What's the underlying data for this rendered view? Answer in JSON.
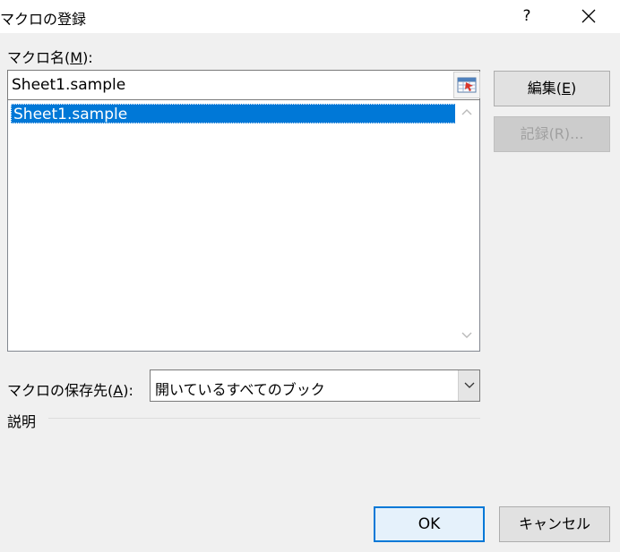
{
  "window": {
    "title": "マクロの登録",
    "help_label": "?"
  },
  "macro_name": {
    "label_prefix": "マクロ名(",
    "label_key": "M",
    "label_suffix": "):",
    "value": "Sheet1.sample"
  },
  "macro_list": {
    "items": [
      "Sheet1.sample"
    ],
    "selected_index": 0
  },
  "buttons": {
    "edit_prefix": "編集(",
    "edit_key": "E",
    "edit_suffix": ")",
    "record": "記録(R)...",
    "ok": "OK",
    "cancel": "キャンセル"
  },
  "save_in": {
    "label_prefix": "マクロの保存先(",
    "label_key": "A",
    "label_suffix": "):",
    "value": "開いているすべてのブック"
  },
  "description": {
    "label": "説明"
  },
  "colors": {
    "selection": "#0078d7",
    "dialog_bg": "#f0f0f0",
    "default_button_border": "#0078d7"
  }
}
